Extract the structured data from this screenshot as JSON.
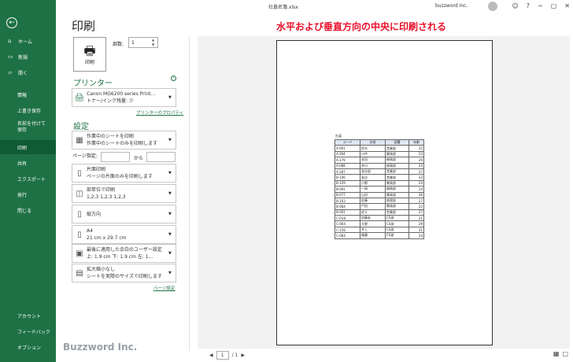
{
  "window": {
    "title": "社員名簿.xlsx",
    "user": "buzzword Inc."
  },
  "sidebar": {
    "items": [
      {
        "icon": "⌂",
        "label": "ホーム"
      },
      {
        "icon": "🗋",
        "label": "新規"
      },
      {
        "icon": "🗁",
        "label": "開く"
      },
      {
        "label": "情報"
      },
      {
        "label": "上書き保存"
      },
      {
        "label": "名前を付けて保存"
      },
      {
        "label": "印刷"
      },
      {
        "label": "共有"
      },
      {
        "label": "エクスポート"
      },
      {
        "label": "発行"
      },
      {
        "label": "閉じる"
      },
      {
        "label": "アカウント"
      },
      {
        "label": "フィードバック"
      },
      {
        "label": "オプション"
      }
    ]
  },
  "print": {
    "title": "印刷",
    "button_label": "印刷",
    "copies_label": "部数:",
    "copies_value": "1",
    "printer_heading": "プリンター",
    "printer_name": "Canon MG6200 series Print…",
    "printer_status": "トナー/インク残量: 少",
    "printer_props_link": "プリンターのプロパティ",
    "settings_heading": "設定",
    "settings": [
      {
        "line1": "作業中のシートを印刷",
        "line2": "作業中のシートのみを印刷します"
      },
      {
        "line1": "片面印刷",
        "line2": "ページの片面のみを印刷します"
      },
      {
        "line1": "部単位で印刷",
        "line2": "1,2,3    1,2,3    1,2,3"
      },
      {
        "line1": "縦方向",
        "line2": ""
      },
      {
        "line1": "A4",
        "line2": "21 cm x 29.7 cm"
      },
      {
        "line1": "最後に適用した余白のユーザー設定",
        "line2": "上: 1.9 cm 下: 1.9 cm 左: 1…"
      },
      {
        "line1": "拡大縮小なし",
        "line2": "シートを実際のサイズで印刷します"
      }
    ],
    "pages_label": "ページ指定:",
    "pages_to": "から",
    "page_setup_link": "ページ設定"
  },
  "preview": {
    "annotation": "水平および垂直方向の中央に印刷される",
    "sheet_title": "社員",
    "headers": [
      "コード",
      "名前",
      "部署",
      "年齢"
    ],
    "rows": [
      [
        "A-001",
        "鈴木",
        "営業部",
        "35"
      ],
      [
        "A-264",
        "川中",
        "開発部",
        "23"
      ],
      [
        "A-179",
        "本田",
        "総務部",
        "29"
      ],
      [
        "A-088",
        "井口",
        "経理部",
        "25"
      ],
      [
        "A-287",
        "長谷部",
        "営業部",
        "27"
      ],
      [
        "B-146",
        "長谷",
        "営業部",
        "33"
      ],
      [
        "B-129",
        "小野",
        "開発部",
        "24"
      ],
      [
        "B-091",
        "一岡",
        "総務部",
        "24"
      ],
      [
        "B-077",
        "山田",
        "開発部",
        "36"
      ],
      [
        "B-103",
        "佐藤",
        "経理部",
        "27"
      ],
      [
        "B-064",
        "戸田",
        "開発部",
        "22"
      ],
      [
        "B-001",
        "佐々",
        "営業部",
        "27"
      ],
      [
        "C-018",
        "加藤友",
        "CS部",
        "21"
      ],
      [
        "C-064",
        "大野",
        "CS部",
        "29"
      ],
      [
        "C-156",
        "井上",
        "CS部",
        "31"
      ],
      [
        "C-064",
        "後藤",
        "CS部",
        "24"
      ]
    ],
    "page_current": "1",
    "page_total": "/ 1"
  },
  "watermark": "Buzzword Inc."
}
